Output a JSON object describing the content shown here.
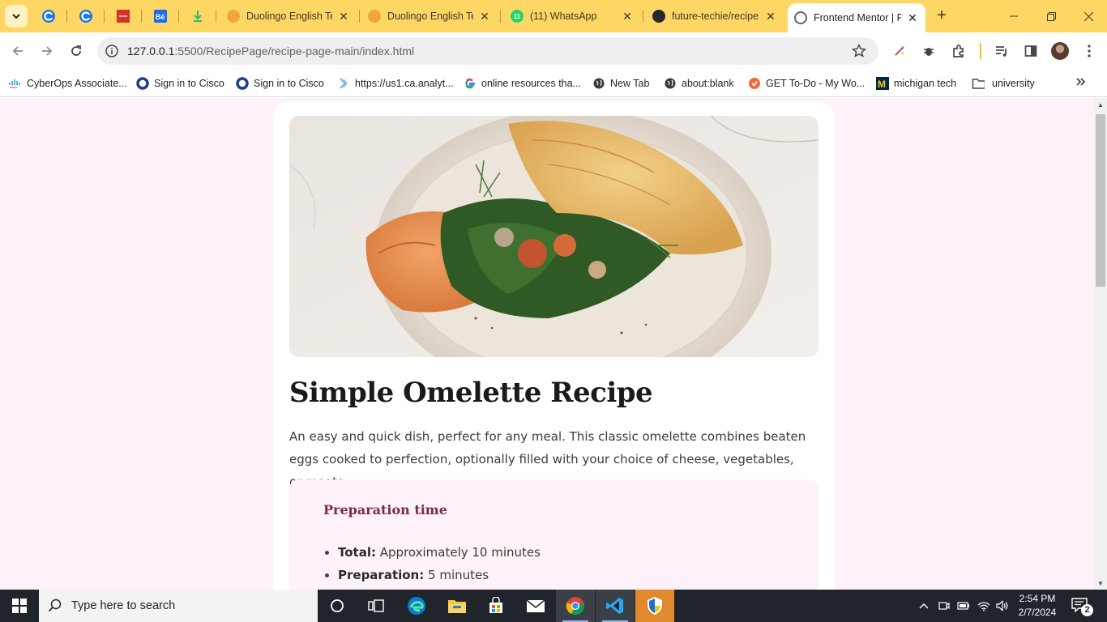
{
  "browser": {
    "tabs": [
      {
        "title": "Duolingo English Te",
        "icon": "duolingo-icon"
      },
      {
        "title": "Duolingo English Te",
        "icon": "duolingo-icon"
      },
      {
        "title": "(11) WhatsApp",
        "icon": "whatsapp-icon"
      },
      {
        "title": "future-techie/recipe",
        "icon": "github-icon"
      },
      {
        "title": "Frontend Mentor | F",
        "icon": "globe-icon",
        "active": true
      }
    ],
    "pinned_tab_badge": "11",
    "url_host": "127.0.0.1",
    "url_rest": ":5500/RecipePage/recipe-page-main/index.html",
    "bookmarks": [
      {
        "label": "CyberOps Associate...",
        "icon": "cisco-icon"
      },
      {
        "label": "Sign in to Cisco",
        "icon": "circle-o-icon"
      },
      {
        "label": "Sign in to Cisco",
        "icon": "circle-o-icon"
      },
      {
        "label": "https://us1.ca.analyt...",
        "icon": "analytics-icon"
      },
      {
        "label": "online resources tha...",
        "icon": "google-icon"
      },
      {
        "label": "New Tab",
        "icon": "globe-icon"
      },
      {
        "label": "about:blank",
        "icon": "globe-icon"
      },
      {
        "label": "GET To-Do - My Wo...",
        "icon": "todo-icon"
      },
      {
        "label": "michigan tech",
        "icon": "michigan-icon"
      },
      {
        "label": "university",
        "icon": "folder-icon"
      }
    ]
  },
  "recipe": {
    "title": "Simple Omelette Recipe",
    "description": "An easy and quick dish, perfect for any meal. This classic omelette combines beaten eggs cooked to perfection, optionally filled with your choice of cheese, vegetables, or meats.",
    "prep": {
      "title": "Preparation time",
      "items": [
        {
          "label": "Total:",
          "value": " Approximately 10 minutes"
        },
        {
          "label": "Preparation:",
          "value": " 5 minutes"
        }
      ]
    }
  },
  "taskbar": {
    "search_placeholder": "Type here to search",
    "time": "2:54 PM",
    "date": "2/7/2024",
    "notification_count": "2"
  },
  "colors": {
    "tabstrip": "#fdd663",
    "page_bg": "#fdf2f9",
    "accent": "#7a2a48"
  }
}
